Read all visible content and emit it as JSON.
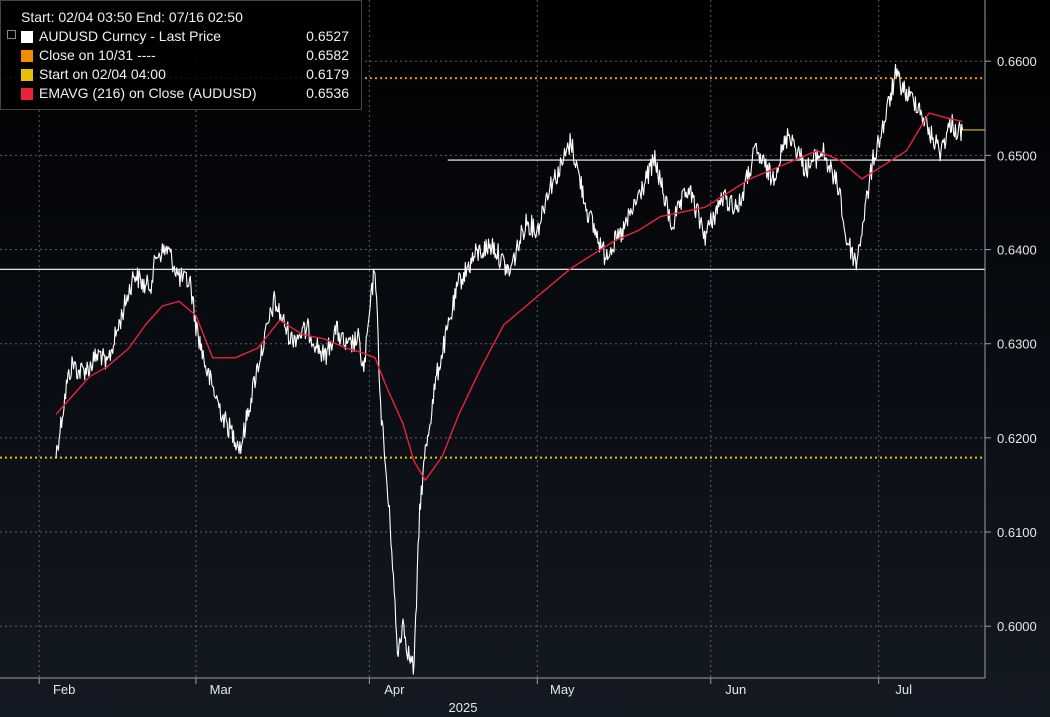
{
  "header": {
    "start_label": "Start:",
    "start_value": "02/04 03:50",
    "end_label": "End:",
    "end_value": "07/16 02:50"
  },
  "legend": {
    "items": [
      {
        "name": "AUDUSD Curncy - Last Price",
        "value": "0.6527",
        "color": "#ffffff"
      },
      {
        "name": "Close on 10/31 ----",
        "value": "0.6582",
        "color": "#f28c00"
      },
      {
        "name": "Start on 02/04 04:00",
        "value": "0.6179",
        "color": "#e6c100"
      },
      {
        "name": "EMAVG (216)  on Close (AUDUSD)",
        "value": "0.6536",
        "color": "#e8233a"
      }
    ]
  },
  "chart_data": {
    "type": "line",
    "x_unit": "date",
    "xlim": [
      "2025-01-25",
      "2025-07-20"
    ],
    "ylim": [
      0.5945,
      0.6665
    ],
    "yticks": [
      0.6,
      0.61,
      0.62,
      0.63,
      0.64,
      0.65,
      0.66
    ],
    "ytick_labels": [
      "0.6000",
      "0.6100",
      "0.6200",
      "0.6300",
      "0.6400",
      "0.6500",
      "0.6600"
    ],
    "xticks": [
      {
        "date": "2025-02-01",
        "label": "Feb"
      },
      {
        "date": "2025-03-01",
        "label": "Mar"
      },
      {
        "date": "2025-04-01",
        "label": "Apr"
      },
      {
        "date": "2025-05-01",
        "label": "May"
      },
      {
        "date": "2025-06-01",
        "label": "Jun"
      },
      {
        "date": "2025-07-01",
        "label": "Jul"
      }
    ],
    "year_label": "2025",
    "grid": true,
    "legend_position": "top-left",
    "series": [
      {
        "name": "AUDUSD Curncy - Last Price",
        "color": "#ffffff",
        "x": [
          "2025-02-04",
          "2025-02-05",
          "2025-02-06",
          "2025-02-07",
          "2025-02-08",
          "2025-02-10",
          "2025-02-11",
          "2025-02-12",
          "2025-02-13",
          "2025-02-14",
          "2025-02-16",
          "2025-02-18",
          "2025-02-20",
          "2025-02-21",
          "2025-02-22",
          "2025-02-24",
          "2025-02-26",
          "2025-02-28",
          "2025-03-01",
          "2025-03-03",
          "2025-03-06",
          "2025-03-09",
          "2025-03-12",
          "2025-03-15",
          "2025-03-18",
          "2025-03-21",
          "2025-03-24",
          "2025-03-26",
          "2025-03-28",
          "2025-03-30",
          "2025-03-31",
          "2025-04-01",
          "2025-04-02",
          "2025-04-03",
          "2025-04-05",
          "2025-04-06",
          "2025-04-07",
          "2025-04-08",
          "2025-04-09",
          "2025-04-10",
          "2025-04-11",
          "2025-04-13",
          "2025-04-15",
          "2025-04-17",
          "2025-04-20",
          "2025-04-23",
          "2025-04-26",
          "2025-04-29",
          "2025-05-01",
          "2025-05-03",
          "2025-05-05",
          "2025-05-07",
          "2025-05-10",
          "2025-05-13",
          "2025-05-16",
          "2025-05-19",
          "2025-05-22",
          "2025-05-25",
          "2025-05-28",
          "2025-05-31",
          "2025-06-03",
          "2025-06-06",
          "2025-06-09",
          "2025-06-12",
          "2025-06-15",
          "2025-06-18",
          "2025-06-21",
          "2025-06-23",
          "2025-06-24",
          "2025-06-25",
          "2025-06-27",
          "2025-06-30",
          "2025-07-02",
          "2025-07-04",
          "2025-07-06",
          "2025-07-08",
          "2025-07-10",
          "2025-07-12",
          "2025-07-14",
          "2025-07-15",
          "2025-07-16"
        ],
        "values": [
          0.6182,
          0.622,
          0.626,
          0.628,
          0.627,
          0.6275,
          0.6285,
          0.629,
          0.6275,
          0.6295,
          0.6335,
          0.6375,
          0.636,
          0.6365,
          0.6395,
          0.64,
          0.637,
          0.6365,
          0.632,
          0.627,
          0.622,
          0.619,
          0.6275,
          0.6345,
          0.6305,
          0.6315,
          0.6285,
          0.6315,
          0.6295,
          0.6305,
          0.627,
          0.633,
          0.6385,
          0.6235,
          0.6085,
          0.597,
          0.6005,
          0.597,
          0.5955,
          0.6125,
          0.6185,
          0.6265,
          0.6315,
          0.6365,
          0.6395,
          0.6405,
          0.6375,
          0.643,
          0.642,
          0.6465,
          0.6485,
          0.6515,
          0.644,
          0.6395,
          0.6415,
          0.6455,
          0.6495,
          0.6425,
          0.6465,
          0.6415,
          0.6455,
          0.6445,
          0.6505,
          0.6475,
          0.6525,
          0.6485,
          0.6505,
          0.6475,
          0.6465,
          0.6415,
          0.6385,
          0.6495,
          0.6535,
          0.6585,
          0.6565,
          0.6555,
          0.6525,
          0.6505,
          0.6535,
          0.6525,
          0.6527
        ]
      },
      {
        "name": "EMAVG (216)  on Close (AUDUSD)",
        "color": "#e8233a",
        "x": [
          "2025-02-04",
          "2025-02-07",
          "2025-02-10",
          "2025-02-13",
          "2025-02-17",
          "2025-02-20",
          "2025-02-23",
          "2025-02-26",
          "2025-03-01",
          "2025-03-04",
          "2025-03-08",
          "2025-03-12",
          "2025-03-16",
          "2025-03-20",
          "2025-03-24",
          "2025-03-28",
          "2025-03-31",
          "2025-04-02",
          "2025-04-04",
          "2025-04-07",
          "2025-04-09",
          "2025-04-11",
          "2025-04-14",
          "2025-04-17",
          "2025-04-21",
          "2025-04-25",
          "2025-04-29",
          "2025-05-03",
          "2025-05-07",
          "2025-05-11",
          "2025-05-15",
          "2025-05-19",
          "2025-05-23",
          "2025-05-27",
          "2025-05-31",
          "2025-06-04",
          "2025-06-08",
          "2025-06-12",
          "2025-06-16",
          "2025-06-20",
          "2025-06-24",
          "2025-06-28",
          "2025-07-02",
          "2025-07-06",
          "2025-07-10",
          "2025-07-13",
          "2025-07-16"
        ],
        "values": [
          0.6225,
          0.6245,
          0.6265,
          0.6275,
          0.6295,
          0.632,
          0.634,
          0.6345,
          0.633,
          0.6285,
          0.6285,
          0.6295,
          0.6325,
          0.631,
          0.6305,
          0.6295,
          0.629,
          0.6285,
          0.6255,
          0.6215,
          0.6175,
          0.6155,
          0.618,
          0.6225,
          0.6275,
          0.632,
          0.634,
          0.636,
          0.638,
          0.6395,
          0.641,
          0.642,
          0.6435,
          0.644,
          0.6445,
          0.646,
          0.6475,
          0.6485,
          0.6495,
          0.6505,
          0.6495,
          0.6475,
          0.649,
          0.6505,
          0.6545,
          0.654,
          0.6536
        ]
      }
    ],
    "reference_lines": [
      {
        "name": "Close on 10/31",
        "value": 0.6582,
        "color": "#f28c00",
        "style": "dotted"
      },
      {
        "name": "Start on 02/04 04:00",
        "value": 0.6179,
        "color": "#e6c100",
        "style": "dotted"
      },
      {
        "value": 0.6495,
        "color": "#ffffff",
        "style": "solid",
        "from": "2025-04-15",
        "to": "2025-07-20"
      },
      {
        "value": 0.6379,
        "color": "#ffffff",
        "style": "solid",
        "from": "2025-01-25",
        "to": "2025-07-20"
      },
      {
        "value": 0.6527,
        "color": "#e6c100",
        "style": "solid",
        "from": "2025-07-16",
        "to": "2025-07-20"
      }
    ]
  }
}
